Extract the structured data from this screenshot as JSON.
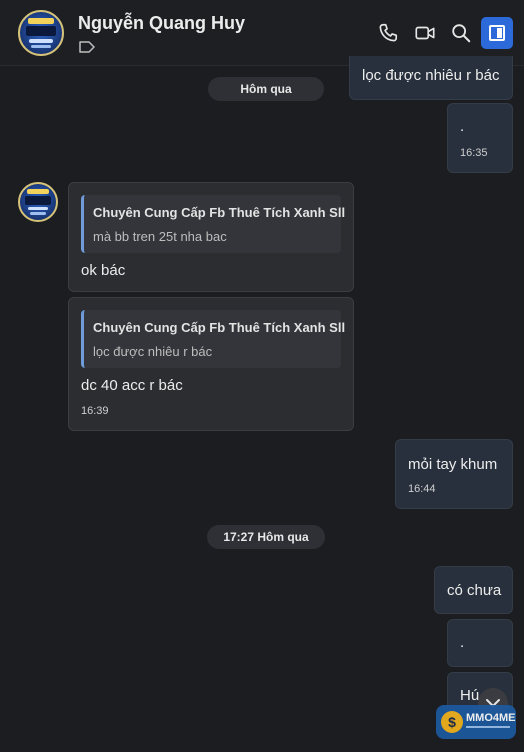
{
  "header": {
    "contact_name": "Nguyễn Quang Huy",
    "icons": [
      "phone-icon",
      "video-icon",
      "search-icon",
      "side-panel-icon"
    ],
    "accent_color": "#2c6ad9"
  },
  "messages": {
    "top_partial": "lọc được nhiêu r bác",
    "day_label_1": "Hôm qua",
    "dot_msg_1": {
      "text": ".",
      "time": "16:35"
    },
    "reply_1": {
      "quote_title": "Chuyên Cung Cấp Fb Thuê Tích Xanh Sll",
      "quote_text": "mà bb tren 25t nha bac",
      "text": "ok bác"
    },
    "reply_2": {
      "quote_title": "Chuyên Cung Cấp Fb Thuê Tích Xanh Sll",
      "quote_text": "lọc được nhiêu r bác",
      "text": "dc 40 acc r bác",
      "time": "16:39"
    },
    "out_1": {
      "text": "mỏi tay khum",
      "time": "16:44"
    },
    "day_label_2": "17:27 Hôm qua",
    "out_2": {
      "text": "có chưa"
    },
    "out_3": {
      "text": "."
    },
    "out_4": {
      "text": "Hú"
    }
  },
  "watermark": {
    "text": "MMO4ME",
    "symbol": "$"
  }
}
